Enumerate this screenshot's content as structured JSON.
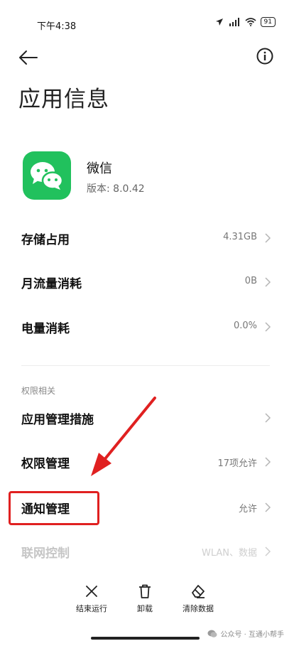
{
  "status_bar": {
    "time": "下午4:38",
    "battery": "91"
  },
  "page": {
    "title": "应用信息"
  },
  "app": {
    "name": "微信",
    "version": "版本: 8.0.42"
  },
  "rows": [
    {
      "label": "存储占用",
      "value": "4.31GB"
    },
    {
      "label": "月流量消耗",
      "value": "0B"
    },
    {
      "label": "电量消耗",
      "value": "0.0%"
    }
  ],
  "permissions": {
    "header": "权限相关",
    "rows": [
      {
        "label": "应用管理措施",
        "value": ""
      },
      {
        "label": "权限管理",
        "value": "17项允许"
      },
      {
        "label": "通知管理",
        "value": "允许"
      },
      {
        "label": "联网控制",
        "value": "WLAN、数据"
      }
    ]
  },
  "bottom_bar": {
    "force_stop": "结束运行",
    "uninstall": "卸载",
    "clear_data": "清除数据"
  },
  "watermark": "公众号 · 互通小帮手",
  "colors": {
    "wechat_green": "#21c15d",
    "annotation_red": "#e02020"
  }
}
